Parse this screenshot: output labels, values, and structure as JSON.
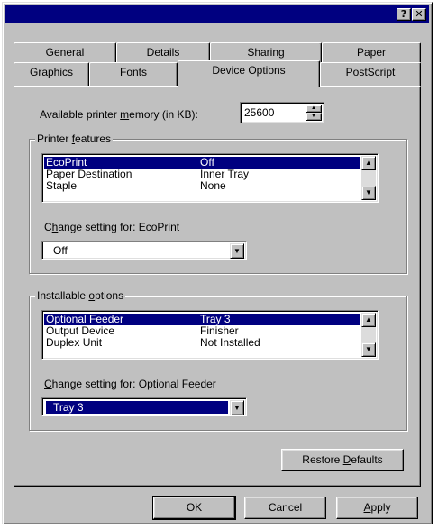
{
  "titlebar": {
    "help_label": "?",
    "close_label": "✕"
  },
  "tabs": {
    "row1": [
      "General",
      "Details",
      "Sharing",
      "Paper"
    ],
    "row2": [
      "Graphics",
      "Fonts",
      "Device Options",
      "PostScript"
    ],
    "active": "Device Options"
  },
  "memory": {
    "label_pre": "Available printer ",
    "label_ul": "m",
    "label_post": "emory (in KB):",
    "value": "25600"
  },
  "printer_features": {
    "group_pre": "Printer ",
    "group_ul": "f",
    "group_post": "eatures",
    "rows": [
      {
        "name": "EcoPrint",
        "value": "Off"
      },
      {
        "name": "Paper Destination",
        "value": "Inner Tray"
      },
      {
        "name": "Staple",
        "value": "None"
      }
    ],
    "change_pre": "C",
    "change_ul": "h",
    "change_post": "ange setting for:  EcoPrint",
    "combo_value": "Off"
  },
  "installable_options": {
    "group_pre": "Installable ",
    "group_ul": "o",
    "group_post": "ptions",
    "rows": [
      {
        "name": "Optional Feeder",
        "value": "Tray 3"
      },
      {
        "name": "Output Device",
        "value": "Finisher"
      },
      {
        "name": "Duplex Unit",
        "value": "Not Installed"
      }
    ],
    "change_ul": "C",
    "change_post": "hange setting for:  Optional Feeder",
    "combo_value": "Tray 3"
  },
  "restore": {
    "pre": "Restore ",
    "ul": "D",
    "post": "efaults"
  },
  "buttons": {
    "ok": "OK",
    "cancel": "Cancel",
    "apply_ul": "A",
    "apply_post": "pply"
  },
  "icons": {
    "scroll_up": "▲",
    "scroll_down": "▼",
    "dropdown": "▼"
  }
}
